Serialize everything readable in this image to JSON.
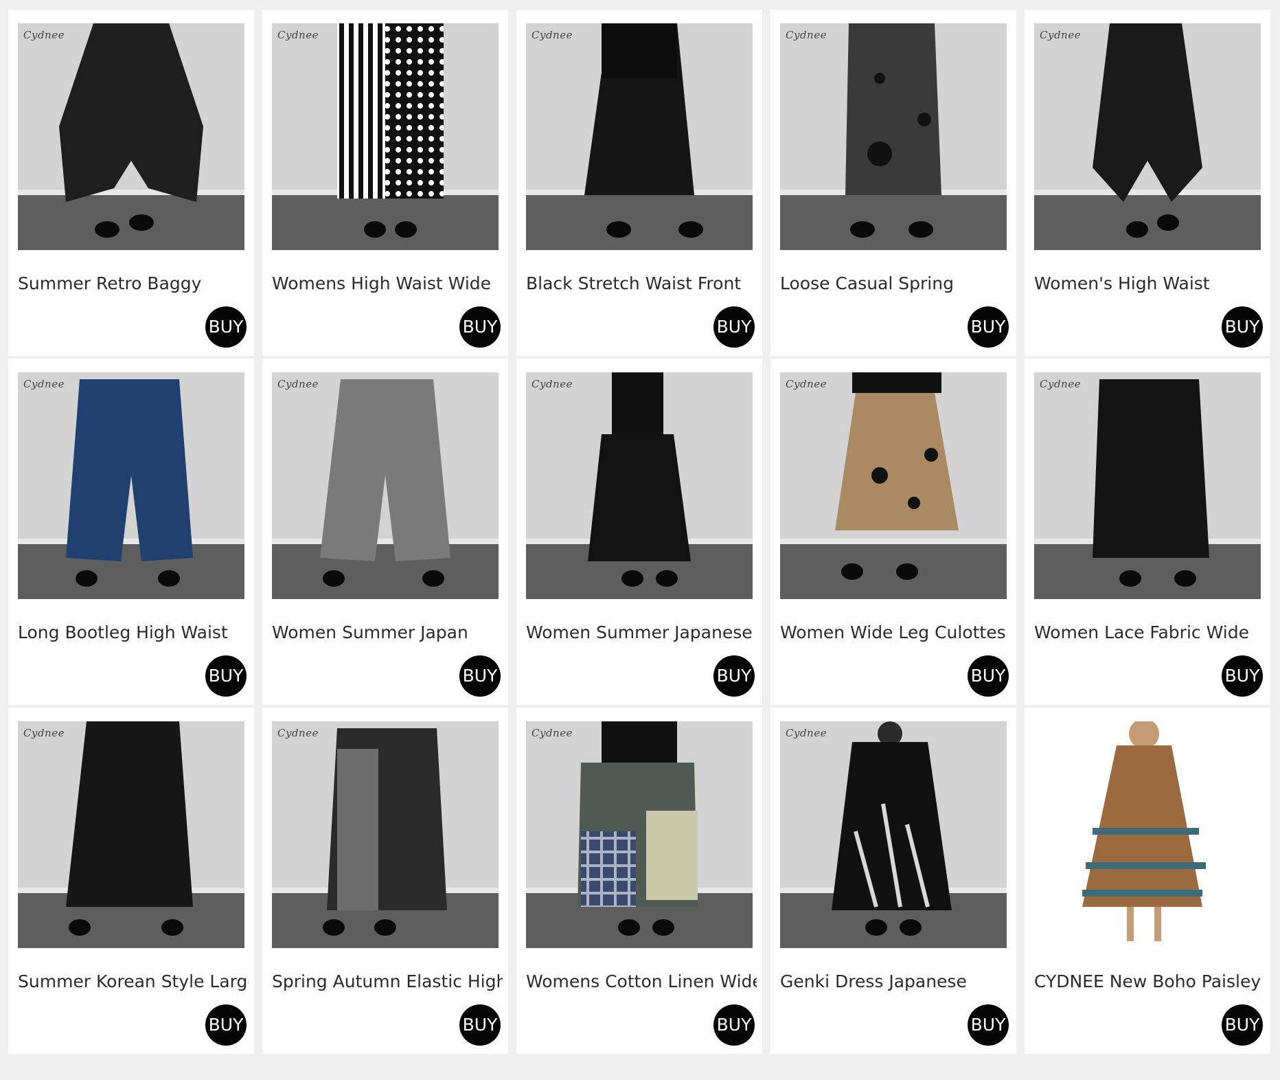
{
  "products": [
    {
      "title": "Summer Retro Baggy",
      "buy_label": "BUY",
      "brand": "Cydnee",
      "color": "#1e1e1e",
      "image": "harem-pants-photo"
    },
    {
      "title": "Womens High Waist Wide",
      "buy_label": "BUY",
      "brand": "Cydnee",
      "color": "#111111",
      "image": "striped-dotted-pants-photo"
    },
    {
      "title": "Black Stretch Waist Front",
      "buy_label": "BUY",
      "brand": "Cydnee",
      "color": "#151515",
      "image": "layered-skirt-pants-photo"
    },
    {
      "title": "Loose Casual Spring",
      "buy_label": "BUY",
      "brand": "Cydnee",
      "color": "#3a3a3a",
      "image": "grey-dot-culottes-photo"
    },
    {
      "title": "Women's High Waist",
      "buy_label": "BUY",
      "brand": "Cydnee",
      "color": "#1a1a1a",
      "image": "lace-harem-pants-photo"
    },
    {
      "title": "Long Bootleg High Waist",
      "buy_label": "BUY",
      "brand": "Cydnee",
      "color": "#20406f",
      "image": "denim-wide-pants-photo"
    },
    {
      "title": "Women Summer Japan",
      "buy_label": "BUY",
      "brand": "Cydnee",
      "color": "#7a7a7a",
      "image": "grey-wide-pants-photo"
    },
    {
      "title": "Women Summer Japanese",
      "buy_label": "BUY",
      "brand": "Cydnee",
      "color": "#121212",
      "image": "black-lace-pants-photo"
    },
    {
      "title": "Women Wide Leg Culottes",
      "buy_label": "BUY",
      "brand": "Cydnee",
      "color": "#a98a62",
      "image": "khaki-dot-culottes-photo"
    },
    {
      "title": "Women Lace Fabric Wide",
      "buy_label": "BUY",
      "brand": "Cydnee",
      "color": "#141414",
      "image": "lace-wide-pants-photo"
    },
    {
      "title": "Summer Korean Style Large",
      "buy_label": "BUY",
      "brand": "Cydnee",
      "color": "#161616",
      "image": "eyelet-wide-pants-photo"
    },
    {
      "title": "Spring Autumn Elastic High",
      "buy_label": "BUY",
      "brand": "Cydnee",
      "color": "#2a2a2a",
      "image": "patchwork-grey-pants-photo"
    },
    {
      "title": "Womens Cotton Linen Wide",
      "buy_label": "BUY",
      "brand": "Cydnee",
      "color": "#4f5a52",
      "image": "plaid-patchwork-pants-photo"
    },
    {
      "title": "Genki Dress Japanese",
      "buy_label": "BUY",
      "brand": "Cydnee",
      "color": "#111111",
      "image": "giraffe-print-dress-photo"
    },
    {
      "title": "CYDNEE New Boho Paisley",
      "buy_label": "BUY",
      "brand": "",
      "color": "#9b6b3f",
      "image": "boho-paisley-dress-photo"
    }
  ]
}
